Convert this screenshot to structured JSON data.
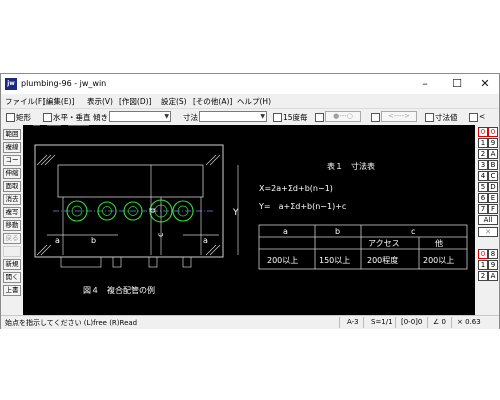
{
  "window": {
    "app_icon": "jw",
    "title": "plumbing-96 - jw_win",
    "minimize": "–",
    "maximize": "☐",
    "close": "✕"
  },
  "menu": [
    "ファイル(F)",
    "[編集(E)]",
    "表示(V)",
    "[作図(D)]",
    "設定(S)",
    "[その他(A)]",
    "ヘルプ(H)"
  ],
  "toolbar": {
    "rect": "矩形",
    "horiz_vert": "水平・垂直",
    "tilt_label": "傾き",
    "dim_label": "寸法",
    "deg15": "15度毎",
    "circle_btn": "●---○",
    "arrow_btn": "<---->",
    "dim_value": "寸法値",
    "lt": "<"
  },
  "left_tools": [
    "範囲",
    "複線",
    "コーナー",
    "伸縮",
    "面取",
    "消去",
    "複写",
    "移動",
    "戻る",
    "",
    "新規",
    "開く",
    "上書"
  ],
  "right_layers": {
    "group1": [
      "0",
      "1",
      "2",
      "3",
      "4",
      "5",
      "6",
      "7",
      "8",
      "9",
      "A",
      "B",
      "C",
      "D",
      "E",
      "F"
    ],
    "all": "All",
    "x": "✕",
    "group2": [
      "0",
      "8",
      "9"
    ]
  },
  "drawing": {
    "table_title": "表１　寸法表",
    "formula1": "X=2a+Σd+b(n−1)",
    "formula2": "Y=　a+Σd+b(n−1)+c",
    "table_headers": [
      "a",
      "b",
      "c"
    ],
    "table_subheaders": [
      "アクセス",
      "他"
    ],
    "table_values": [
      "200以上",
      "150以上",
      "200程度",
      "200以上"
    ],
    "figure_caption": "図４　複合配管の例",
    "dim_a": "a",
    "dim_b": "b",
    "dim_c": "c",
    "dim_d": "d",
    "dim_x": "X",
    "dim_y": "Y"
  },
  "status": {
    "prompt": "始点を指示してください (L)free (R)Read",
    "paper": "A-3",
    "scale": "S=1/1",
    "layer": "[0-0]0",
    "angle": "∠ 0",
    "zoom": "× 0.63"
  }
}
